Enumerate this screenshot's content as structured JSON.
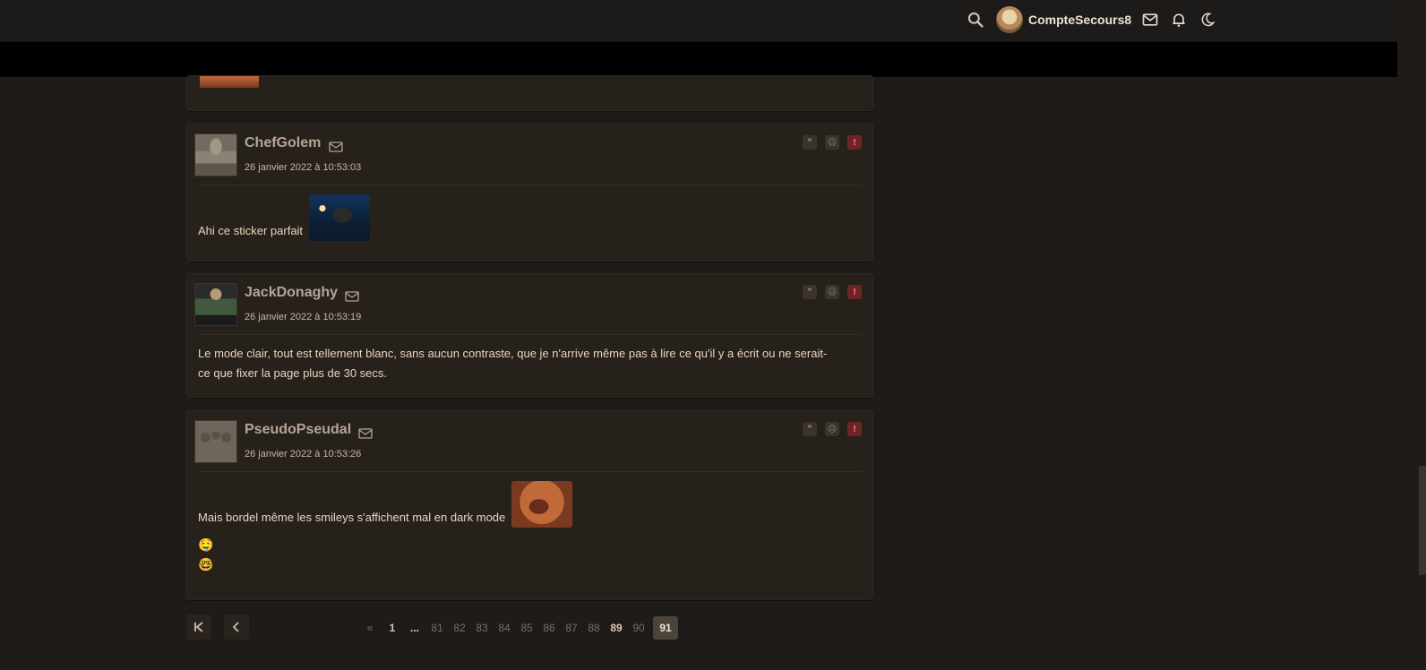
{
  "header": {
    "username": "CompteSecours8",
    "icons": [
      "search-icon",
      "mail-icon",
      "bell-icon",
      "moon-icon"
    ]
  },
  "posts": [
    {
      "author": "ChefGolem",
      "date": "26 janvier 2022 à 10:53:03",
      "text": "Ahi ce sticker parfait"
    },
    {
      "author": "JackDonaghy",
      "date": "26 janvier 2022 à 10:53:19",
      "text_line1": "Le mode clair, tout est tellement blanc, sans aucun contraste, que je n'arrive même pas à lire ce qu'il y a écrit ou ne serait-",
      "text_line2": "ce que fixer la page plus de 30 secs."
    },
    {
      "author": "PseudoPseudal",
      "date": "26 janvier 2022 à 10:53:26",
      "text": "Mais bordel même les smileys s'affichent mal en dark mode",
      "smiley1": "🤤",
      "smiley2": "🤓"
    }
  ],
  "pagination": {
    "prev_symbol": "«",
    "pages": [
      "1",
      "...",
      "81",
      "82",
      "83",
      "84",
      "85",
      "86",
      "87",
      "88",
      "89",
      "90",
      "91"
    ],
    "current": "91"
  },
  "colors": {
    "background": "#1f1b18",
    "card": "#27211c",
    "report_red": "#6e2424"
  }
}
